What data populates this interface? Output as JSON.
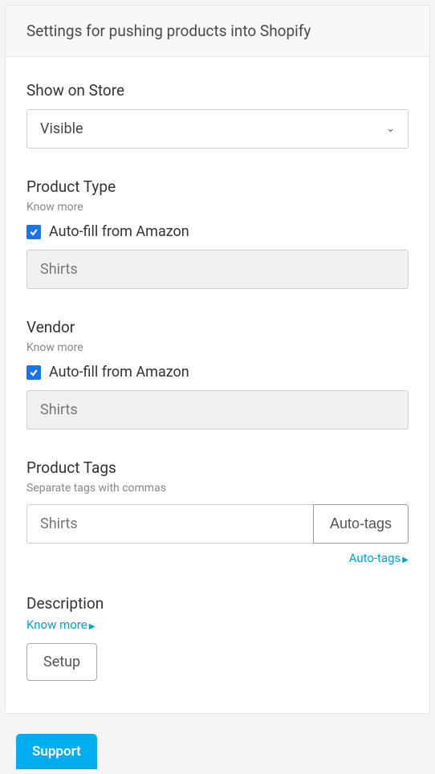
{
  "header": {
    "title": "Settings for pushing products into Shopify"
  },
  "show_on_store": {
    "label": "Show on Store",
    "value": "Visible"
  },
  "product_type": {
    "label": "Product Type",
    "hint": "Know more",
    "autofill_label": "Auto-fill from Amazon",
    "autofill_checked": true,
    "value": "Shirts"
  },
  "vendor": {
    "label": "Vendor",
    "hint": "Know more",
    "autofill_label": "Auto-fill from Amazon",
    "autofill_checked": true,
    "value": "Shirts"
  },
  "product_tags": {
    "label": "Product Tags",
    "hint": "Separate tags with commas",
    "value": "",
    "placeholder": "Shirts",
    "button": "Auto-tags",
    "link": "Auto-tags"
  },
  "description": {
    "label": "Description",
    "link": "Know more",
    "button": "Setup"
  },
  "support": {
    "label": "Support"
  }
}
